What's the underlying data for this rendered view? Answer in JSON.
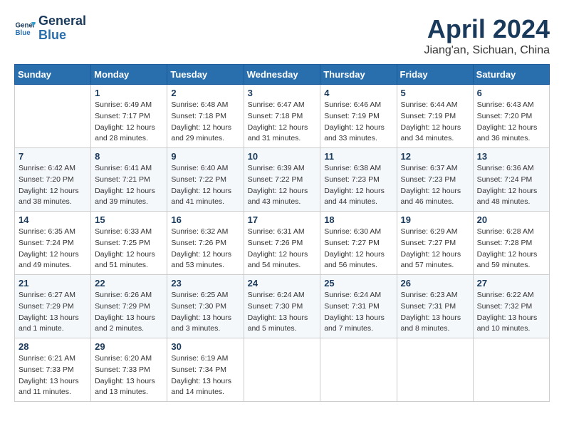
{
  "header": {
    "logo_line1": "General",
    "logo_line2": "Blue",
    "month": "April 2024",
    "location": "Jiang'an, Sichuan, China"
  },
  "weekdays": [
    "Sunday",
    "Monday",
    "Tuesday",
    "Wednesday",
    "Thursday",
    "Friday",
    "Saturday"
  ],
  "weeks": [
    [
      {
        "day": "",
        "info": ""
      },
      {
        "day": "1",
        "info": "Sunrise: 6:49 AM\nSunset: 7:17 PM\nDaylight: 12 hours\nand 28 minutes."
      },
      {
        "day": "2",
        "info": "Sunrise: 6:48 AM\nSunset: 7:18 PM\nDaylight: 12 hours\nand 29 minutes."
      },
      {
        "day": "3",
        "info": "Sunrise: 6:47 AM\nSunset: 7:18 PM\nDaylight: 12 hours\nand 31 minutes."
      },
      {
        "day": "4",
        "info": "Sunrise: 6:46 AM\nSunset: 7:19 PM\nDaylight: 12 hours\nand 33 minutes."
      },
      {
        "day": "5",
        "info": "Sunrise: 6:44 AM\nSunset: 7:19 PM\nDaylight: 12 hours\nand 34 minutes."
      },
      {
        "day": "6",
        "info": "Sunrise: 6:43 AM\nSunset: 7:20 PM\nDaylight: 12 hours\nand 36 minutes."
      }
    ],
    [
      {
        "day": "7",
        "info": "Sunrise: 6:42 AM\nSunset: 7:20 PM\nDaylight: 12 hours\nand 38 minutes."
      },
      {
        "day": "8",
        "info": "Sunrise: 6:41 AM\nSunset: 7:21 PM\nDaylight: 12 hours\nand 39 minutes."
      },
      {
        "day": "9",
        "info": "Sunrise: 6:40 AM\nSunset: 7:22 PM\nDaylight: 12 hours\nand 41 minutes."
      },
      {
        "day": "10",
        "info": "Sunrise: 6:39 AM\nSunset: 7:22 PM\nDaylight: 12 hours\nand 43 minutes."
      },
      {
        "day": "11",
        "info": "Sunrise: 6:38 AM\nSunset: 7:23 PM\nDaylight: 12 hours\nand 44 minutes."
      },
      {
        "day": "12",
        "info": "Sunrise: 6:37 AM\nSunset: 7:23 PM\nDaylight: 12 hours\nand 46 minutes."
      },
      {
        "day": "13",
        "info": "Sunrise: 6:36 AM\nSunset: 7:24 PM\nDaylight: 12 hours\nand 48 minutes."
      }
    ],
    [
      {
        "day": "14",
        "info": "Sunrise: 6:35 AM\nSunset: 7:24 PM\nDaylight: 12 hours\nand 49 minutes."
      },
      {
        "day": "15",
        "info": "Sunrise: 6:33 AM\nSunset: 7:25 PM\nDaylight: 12 hours\nand 51 minutes."
      },
      {
        "day": "16",
        "info": "Sunrise: 6:32 AM\nSunset: 7:26 PM\nDaylight: 12 hours\nand 53 minutes."
      },
      {
        "day": "17",
        "info": "Sunrise: 6:31 AM\nSunset: 7:26 PM\nDaylight: 12 hours\nand 54 minutes."
      },
      {
        "day": "18",
        "info": "Sunrise: 6:30 AM\nSunset: 7:27 PM\nDaylight: 12 hours\nand 56 minutes."
      },
      {
        "day": "19",
        "info": "Sunrise: 6:29 AM\nSunset: 7:27 PM\nDaylight: 12 hours\nand 57 minutes."
      },
      {
        "day": "20",
        "info": "Sunrise: 6:28 AM\nSunset: 7:28 PM\nDaylight: 12 hours\nand 59 minutes."
      }
    ],
    [
      {
        "day": "21",
        "info": "Sunrise: 6:27 AM\nSunset: 7:29 PM\nDaylight: 13 hours\nand 1 minute."
      },
      {
        "day": "22",
        "info": "Sunrise: 6:26 AM\nSunset: 7:29 PM\nDaylight: 13 hours\nand 2 minutes."
      },
      {
        "day": "23",
        "info": "Sunrise: 6:25 AM\nSunset: 7:30 PM\nDaylight: 13 hours\nand 3 minutes."
      },
      {
        "day": "24",
        "info": "Sunrise: 6:24 AM\nSunset: 7:30 PM\nDaylight: 13 hours\nand 5 minutes."
      },
      {
        "day": "25",
        "info": "Sunrise: 6:24 AM\nSunset: 7:31 PM\nDaylight: 13 hours\nand 7 minutes."
      },
      {
        "day": "26",
        "info": "Sunrise: 6:23 AM\nSunset: 7:31 PM\nDaylight: 13 hours\nand 8 minutes."
      },
      {
        "day": "27",
        "info": "Sunrise: 6:22 AM\nSunset: 7:32 PM\nDaylight: 13 hours\nand 10 minutes."
      }
    ],
    [
      {
        "day": "28",
        "info": "Sunrise: 6:21 AM\nSunset: 7:33 PM\nDaylight: 13 hours\nand 11 minutes."
      },
      {
        "day": "29",
        "info": "Sunrise: 6:20 AM\nSunset: 7:33 PM\nDaylight: 13 hours\nand 13 minutes."
      },
      {
        "day": "30",
        "info": "Sunrise: 6:19 AM\nSunset: 7:34 PM\nDaylight: 13 hours\nand 14 minutes."
      },
      {
        "day": "",
        "info": ""
      },
      {
        "day": "",
        "info": ""
      },
      {
        "day": "",
        "info": ""
      },
      {
        "day": "",
        "info": ""
      }
    ]
  ]
}
